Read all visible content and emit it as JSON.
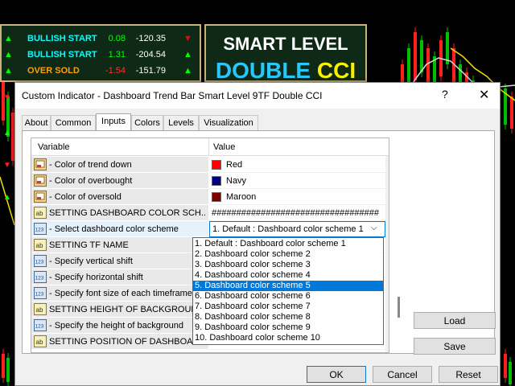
{
  "background_chart": {
    "dashboard_rows": [
      {
        "label": "BULLISH START",
        "v1": "0.08",
        "v2": "-120.35",
        "label_color": "#00ffff",
        "v1_color": "#00ff00",
        "arrow": "▲",
        "arrow_color": "#00ff00",
        "arrow2": "▼",
        "arrow2_color": "#ff0000"
      },
      {
        "label": "BULLISH START",
        "v1": "1.31",
        "v2": "-204.54",
        "label_color": "#00ffff",
        "v1_color": "#00ff00",
        "arrow": "▲",
        "arrow_color": "#00ff00",
        "arrow2": "▲",
        "arrow2_color": "#00ff00"
      },
      {
        "label": "OVER SOLD",
        "v1": "-1.54",
        "v2": "-151.79",
        "label_color": "#ffa000",
        "v1_color": "#ff3030",
        "arrow": "▲",
        "arrow_color": "#00ff00",
        "arrow2": "▲",
        "arrow2_color": "#00ff00"
      }
    ],
    "title_line1": "SMART LEVEL",
    "title_word1": "DOUBLE",
    "title_word2": "CCI",
    "left_arrows": [
      "▼",
      "▲",
      "▼",
      "▲"
    ]
  },
  "dialog": {
    "title": "Custom Indicator - Dashboard Trend Bar Smart Level 9TF Double CCI",
    "help_icon": "?",
    "close_icon": "✕",
    "tabs": [
      "About",
      "Common",
      "Inputs",
      "Colors",
      "Levels",
      "Visualization"
    ],
    "active_tab": "Inputs",
    "columns": {
      "variable": "Variable",
      "value": "Value"
    },
    "rows": [
      {
        "icon": "color",
        "variable": "- Color of trend down",
        "value": "Red",
        "swatch": "#ff0000"
      },
      {
        "icon": "color",
        "variable": "- Color of overbought",
        "value": "Navy",
        "swatch": "#000080"
      },
      {
        "icon": "color",
        "variable": "- Color of oversold",
        "value": "Maroon",
        "swatch": "#800000"
      },
      {
        "icon": "ab",
        "variable": "SETTING DASHBOARD COLOR SCH...",
        "value": "##################################"
      },
      {
        "icon": "123",
        "variable": "- Select dashboard color scheme",
        "value": "1. Default : Dashboard color scheme 1",
        "selected": true
      },
      {
        "icon": "ab",
        "variable": "SETTING TF NAME",
        "value": ""
      },
      {
        "icon": "123",
        "variable": "- Specify vertical shift",
        "value": ""
      },
      {
        "icon": "123",
        "variable": "- Specify horizontal shift",
        "value": ""
      },
      {
        "icon": "123",
        "variable": "- Specify font size of each timeframe in ...",
        "value": ""
      },
      {
        "icon": "ab",
        "variable": "SETTING HEIGHT OF BACKGROUND",
        "value": ""
      },
      {
        "icon": "123",
        "variable": "- Specify the height of background",
        "value": ""
      },
      {
        "icon": "ab",
        "variable": "SETTING POSITION OF DASHBOAR...",
        "value": ""
      }
    ],
    "dropdown_options": [
      "1. Default : Dashboard color scheme 1",
      "2. Dashboard color scheme 2",
      "3. Dashboard color scheme 3",
      "4. Dashboard color scheme 4",
      "5. Dashboard color scheme 5",
      "6. Dashboard color scheme 6",
      "7. Dashboard color scheme 7",
      "8. Dashboard color scheme 8",
      "9. Dashboard color scheme 9",
      "10. Dashboard color scheme 10"
    ],
    "dropdown_highlighted": 4,
    "buttons": {
      "load": "Load",
      "save": "Save",
      "ok": "OK",
      "cancel": "Cancel",
      "reset": "Reset"
    }
  }
}
